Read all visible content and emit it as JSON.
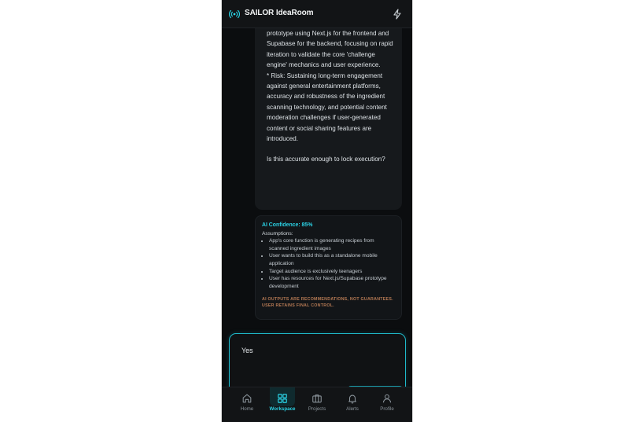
{
  "app": {
    "title": "SAILOR IdeaRoom"
  },
  "message": {
    "lines": [
      "prototype using Next.js for the frontend and Supabase for the backend, focusing on rapid iteration to validate the core 'challenge engine' mechanics and user experience.",
      "* Risk: Sustaining long-term engagement against general entertainment platforms, accuracy and robustness of the ingredient scanning technology, and potential content moderation challenges if user-generated content or social sharing features are introduced."
    ],
    "question": "Is this accurate enough to lock execution?"
  },
  "meta": {
    "confidence_label": "AI Confidence: 85%",
    "assumptions_label": "Assumptions:",
    "assumptions": [
      "App's core function is generating recipes from scanned ingredient images",
      "User wants to build this as a standalone mobile application",
      "Target audience is exclusively teenagers",
      "User has resources for Next.js/Supabase prototype development"
    ],
    "disclaimer": "AI OUTPUTS ARE RECOMMENDATIONS, NOT GUARANTEES. USER RETAINS FINAL CONTROL."
  },
  "input": {
    "value": "Yes"
  },
  "tabs": [
    {
      "label": "Home",
      "icon": "home-icon"
    },
    {
      "label": "Workspace",
      "icon": "grid-icon",
      "active": true
    },
    {
      "label": "Projects",
      "icon": "briefcase-icon"
    },
    {
      "label": "Alerts",
      "icon": "bell-icon"
    },
    {
      "label": "Profile",
      "icon": "user-icon"
    }
  ],
  "colors": {
    "accent": "#2bd3e6",
    "background": "#0b0d0f",
    "warning": "#b67a54"
  }
}
